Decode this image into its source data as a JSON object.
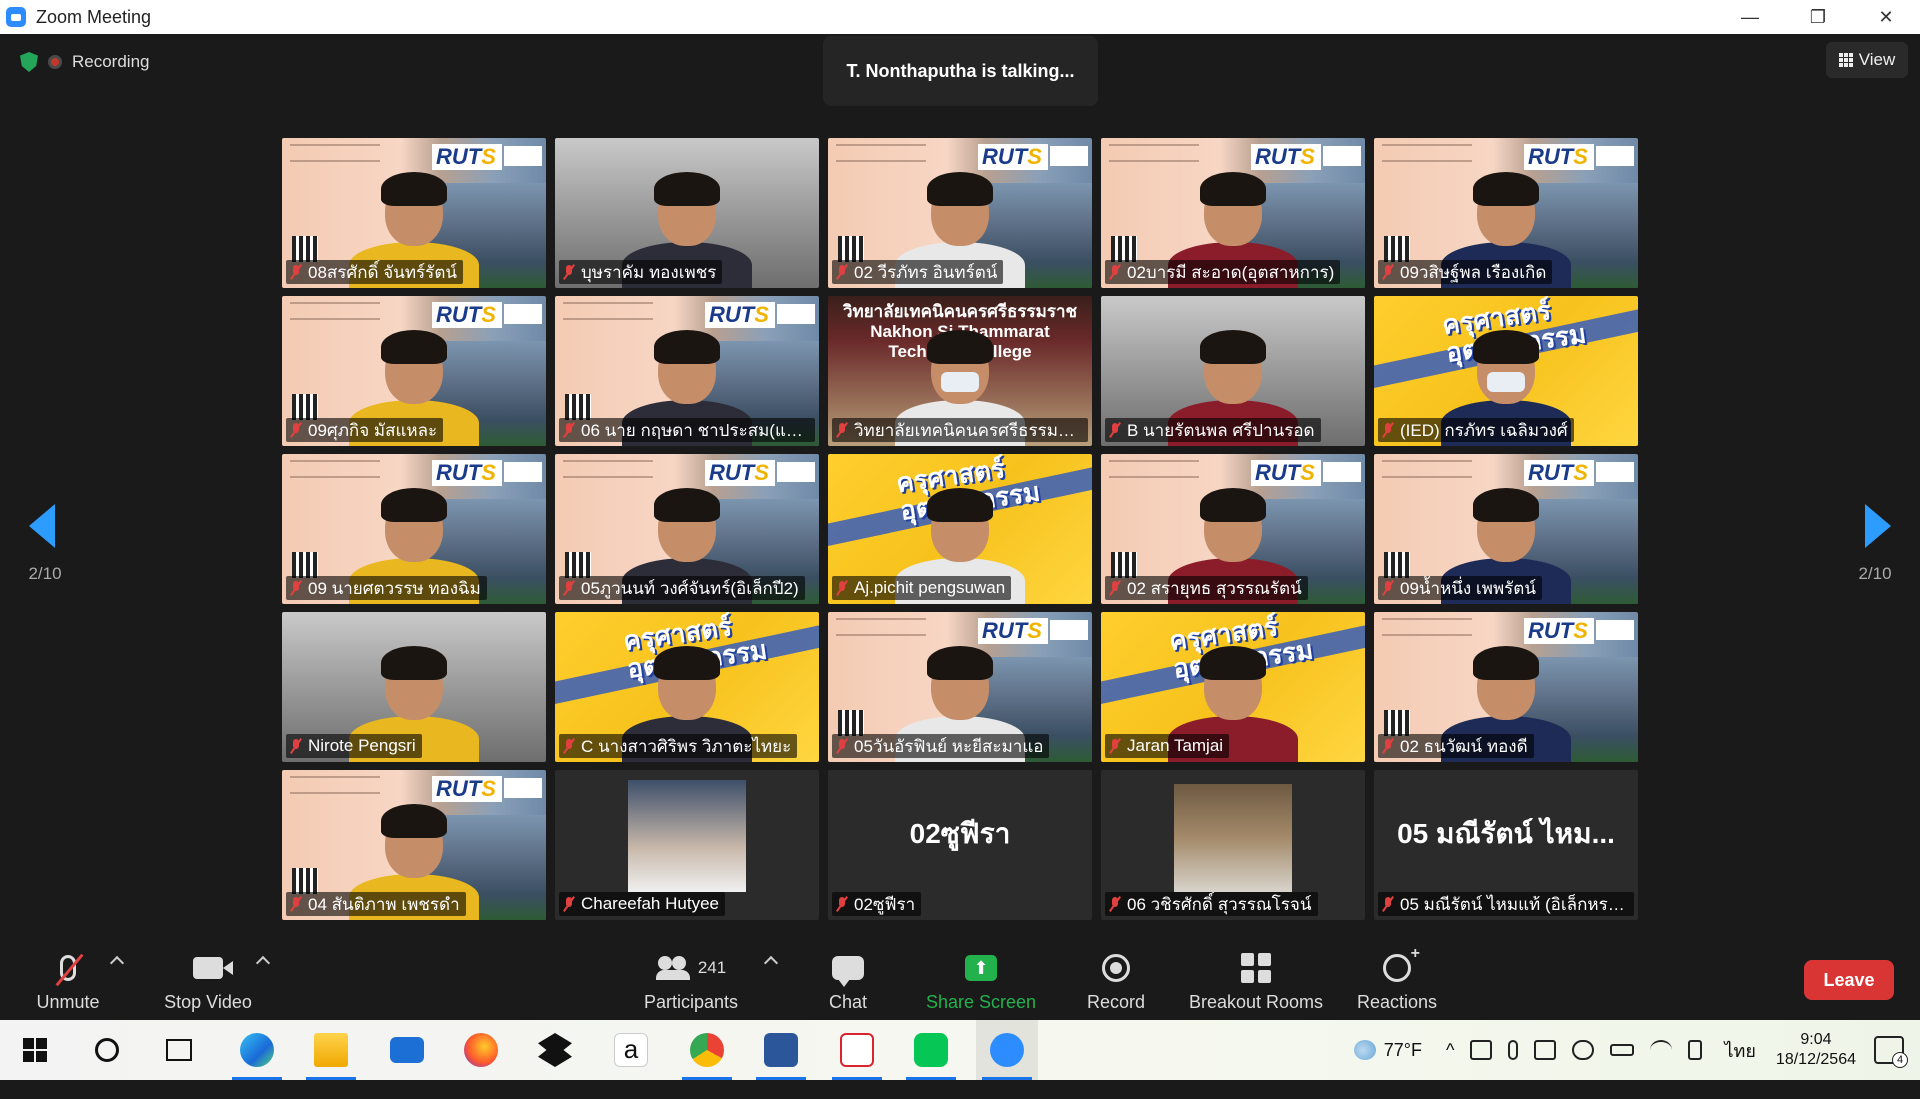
{
  "window": {
    "title": "Zoom Meeting",
    "minimize": "—",
    "restore": "❐",
    "close": "✕"
  },
  "meeting": {
    "recording_label": "Recording",
    "talking": "T. Nonthaputha is talking...",
    "view_label": "View",
    "page_left": "2/10",
    "page_right": "2/10"
  },
  "tiles": [
    {
      "name": "08สรศักดิ์ จันทร์รัตน์",
      "bg": "rut"
    },
    {
      "name": "บุษราคัม ทองเพชร",
      "bg": "room"
    },
    {
      "name": "02 วีรภัทร อินทร์ตน์",
      "bg": "rut"
    },
    {
      "name": "02บารมี สะอาด(อุตสาหการ)",
      "bg": "rut"
    },
    {
      "name": "09วสิษฐ์พล เรืองเกิด",
      "bg": "rut"
    },
    {
      "name": "09ศุภกิจ มัสแหละ",
      "bg": "rut"
    },
    {
      "name": "06 นาย กฤษดา ชาประสม(แม...",
      "bg": "rut"
    },
    {
      "name": "วิทยาลัยเทคนิคนครศรีธรรมราช",
      "bg": "college",
      "banner": "วิทยาลัยเทคนิคนครศรีธรรมราช Nakhon Si Thammarat Technical College"
    },
    {
      "name": "B นายรัตนพล ศรีปานรอด",
      "bg": "room"
    },
    {
      "name": "(IED) กรภัทร เฉลิมวงศ์",
      "bg": "yellow",
      "banner": "ครุศาสตร์ อุตสาหกรรม"
    },
    {
      "name": "09 นายศตวรรษ ทองฉิม",
      "bg": "rut"
    },
    {
      "name": "05ภูวนนท์ วงศ์จันทร์(อิเล็กปี2)",
      "bg": "rut"
    },
    {
      "name": "Aj.pichit pengsuwan",
      "bg": "yellow",
      "banner": "ครุศาสตร์ อุตสาหกรรม"
    },
    {
      "name": "02 สรายุทธ สุวรรณรัตน์",
      "bg": "rut"
    },
    {
      "name": "09น้ำหนึ่ง เพพรัตน์",
      "bg": "rut"
    },
    {
      "name": "Nirote  Pengsri",
      "bg": "room"
    },
    {
      "name": "C นางสาวศิริพร วิภาตะไทยะ",
      "bg": "yellow",
      "banner": "ครุศาสตร์ อุตสาหกรรม"
    },
    {
      "name": "05วันอัรฟินย์ หะยีสะมาแอ",
      "bg": "rut"
    },
    {
      "name": "Jaran Tamjai",
      "bg": "yellow",
      "banner": "ครุศาสตร์ อุตสาหกรรม"
    },
    {
      "name": "02 ธนวัฒน์ ทองดี",
      "bg": "rut"
    },
    {
      "name": "04 สันติภาพ  เพชรดำ",
      "bg": "rut"
    },
    {
      "name": "Chareefah Hutyee",
      "bg": "avatar"
    },
    {
      "name": "02ซูฟีรา",
      "bg": "dark",
      "big": "02ซูฟีรา"
    },
    {
      "name": "06 วชิรศักดิ์ สุวรรณโรจน์",
      "bg": "avatar-boy"
    },
    {
      "name": "05 มณีรัตน์ ไหมแท้ (อิเล็กหรอ...",
      "bg": "dark",
      "big": "05 มณีรัตน์ ไหม..."
    }
  ],
  "toolbar": {
    "unmute": "Unmute",
    "stop_video": "Stop Video",
    "participants": "Participants",
    "participants_count": "241",
    "chat": "Chat",
    "share_screen": "Share Screen",
    "record": "Record",
    "breakout_rooms": "Breakout Rooms",
    "reactions": "Reactions",
    "leave": "Leave"
  },
  "taskbar": {
    "weather": "77°F",
    "language": "ไทย",
    "time": "9:04",
    "date": "18/12/2564",
    "notification_count": "4",
    "apps": [
      "windows-start",
      "search",
      "task-view",
      "edge",
      "file-explorer",
      "mail",
      "firefox",
      "dropbox",
      "amazon",
      "chrome",
      "word",
      "acrobat",
      "line",
      "zoom"
    ]
  },
  "colors": {
    "share_green": "#23b14d",
    "leave_red": "#d93535",
    "nav_blue": "#2d9cff",
    "rut_yellow": "#f7c21c"
  }
}
